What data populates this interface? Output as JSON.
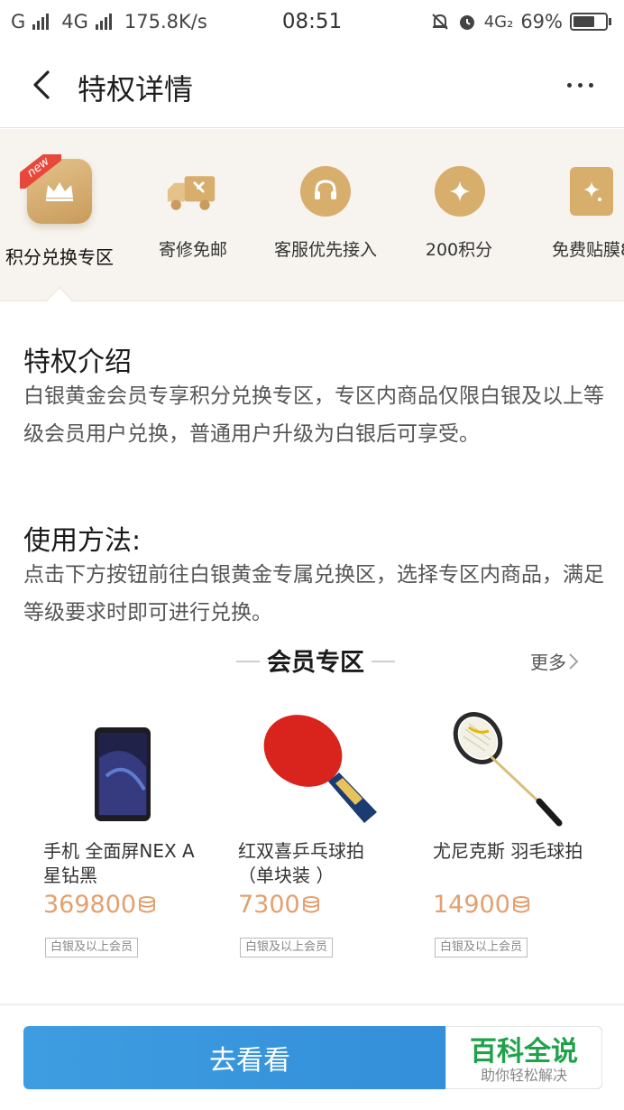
{
  "status_bar": {
    "carrier1": "G",
    "carrier2": "4G",
    "speed": "175.8K/s",
    "time": "08:51",
    "network": "4G₂",
    "battery": "69%",
    "battery_level": 0.69
  },
  "nav": {
    "title": "特权详情",
    "back_icon": "chevron-left-icon",
    "more_icon": "more-dots-icon"
  },
  "privileges": {
    "new_badge": "new",
    "items": [
      {
        "label": "积分兑换专区",
        "icon": "crown-icon",
        "active": true
      },
      {
        "label": "寄修免邮",
        "icon": "repair-truck-icon"
      },
      {
        "label": "客服优先接入",
        "icon": "headset-icon"
      },
      {
        "label": "200积分",
        "icon": "star-spark-icon"
      },
      {
        "label": "免费贴膜8",
        "icon": "film-card-icon"
      }
    ]
  },
  "intro": {
    "title": "特权介绍",
    "body": "白银黄金会员专享积分兑换专区，专区内商品仅限白银及以上等级会员用户兑换，普通用户升级为白银后可享受。"
  },
  "usage": {
    "title": "使用方法:",
    "body": "点击下方按钮前往白银黄金专属兑换区，选择专区内商品，满足等级要求时即可进行兑换。"
  },
  "member_zone": {
    "title": "会员专区",
    "more_label": "更多",
    "products": [
      {
        "name": "手机 全面屏NEX A 星钻黑",
        "price": "369800",
        "tag": "白银及以上会员"
      },
      {
        "name": "红双喜乒乓球拍（单块装 ）",
        "price": "7300",
        "tag": "白银及以上会员"
      },
      {
        "name": "尤尼克斯 羽毛球拍",
        "price": "14900",
        "tag": "白银及以上会员"
      }
    ]
  },
  "footer": {
    "button_label": "去看看"
  },
  "watermark": {
    "title": "百科全说",
    "subtitle": "助你轻松解决"
  },
  "colors": {
    "gold": "#d8ae6c",
    "price": "#e3a070",
    "button": "#3e9de1",
    "watermark_green": "#1fa34a"
  }
}
